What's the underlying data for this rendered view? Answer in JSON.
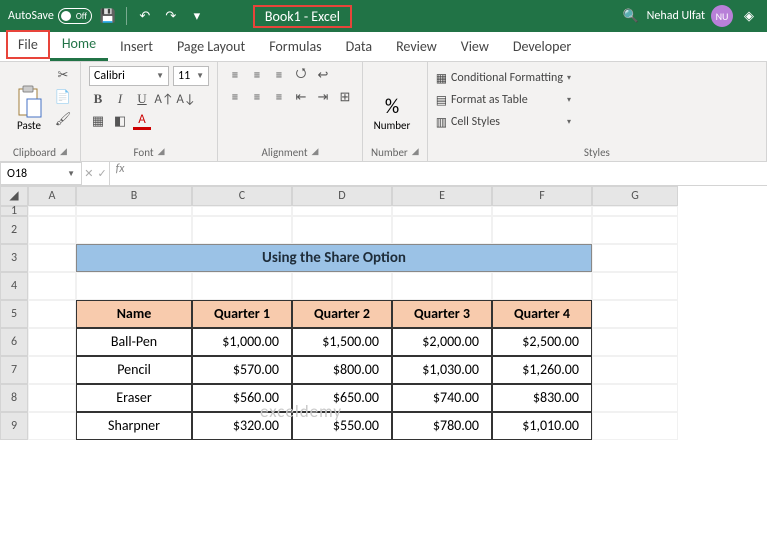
{
  "titlebar": {
    "autosave_label": "AutoSave",
    "autosave_state": "Off",
    "doc_title": "Book1  -  Excel",
    "user_name": "Nehad Ulfat",
    "user_initials": "NU"
  },
  "tabs": {
    "file": "File",
    "home": "Home",
    "insert": "Insert",
    "page_layout": "Page Layout",
    "formulas": "Formulas",
    "data": "Data",
    "review": "Review",
    "view": "View",
    "developer": "Developer"
  },
  "ribbon": {
    "clipboard_label": "Clipboard",
    "paste_label": "Paste",
    "font_label": "Font",
    "font_name": "Calibri",
    "font_size": "11",
    "alignment_label": "Alignment",
    "number_label": "Number",
    "number_btn": "Number",
    "percent_glyph": "%",
    "styles_label": "Styles",
    "cond_fmt": "Conditional Formatting",
    "fmt_table": "Format as Table",
    "cell_styles": "Cell Styles"
  },
  "formula_bar": {
    "name_box": "O18",
    "fx": "fx",
    "value": ""
  },
  "columns": [
    "A",
    "B",
    "C",
    "D",
    "E",
    "F",
    "G"
  ],
  "rows": [
    "1",
    "2",
    "3",
    "4",
    "5",
    "6",
    "7",
    "8",
    "9"
  ],
  "sheet": {
    "title": "Using the Share Option",
    "headers": [
      "Name",
      "Quarter 1",
      "Quarter 2",
      "Quarter 3",
      "Quarter 4"
    ],
    "data": [
      [
        "Ball-Pen",
        "$1,000.00",
        "$1,500.00",
        "$2,000.00",
        "$2,500.00"
      ],
      [
        "Pencil",
        "$570.00",
        "$800.00",
        "$1,030.00",
        "$1,260.00"
      ],
      [
        "Eraser",
        "$560.00",
        "$650.00",
        "$740.00",
        "$830.00"
      ],
      [
        "Sharpner",
        "$320.00",
        "$550.00",
        "$780.00",
        "$1,010.00"
      ]
    ]
  },
  "watermark": "exceldemy",
  "chart_data": {
    "type": "table",
    "title": "Using the Share Option",
    "categories": [
      "Ball-Pen",
      "Pencil",
      "Eraser",
      "Sharpner"
    ],
    "series": [
      {
        "name": "Quarter 1",
        "values": [
          1000,
          570,
          560,
          320
        ]
      },
      {
        "name": "Quarter 2",
        "values": [
          1500,
          800,
          650,
          550
        ]
      },
      {
        "name": "Quarter 3",
        "values": [
          2000,
          1030,
          740,
          780
        ]
      },
      {
        "name": "Quarter 4",
        "values": [
          2500,
          1260,
          830,
          1010
        ]
      }
    ],
    "xlabel": "",
    "ylabel": "",
    "ylim": [
      0,
      2500
    ]
  }
}
